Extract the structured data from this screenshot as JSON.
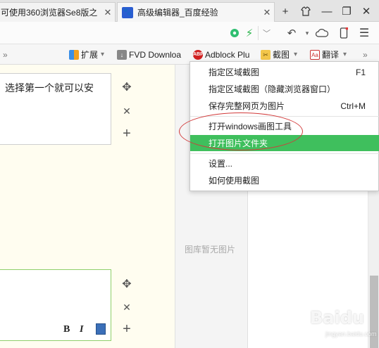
{
  "tabs": [
    {
      "title": "可使用360浏览器Se8版之",
      "close": "✕"
    },
    {
      "title": "高级编辑器_百度经验",
      "close": "✕",
      "favicon": "paw-icon"
    }
  ],
  "window_controls": {
    "new_tab": "+",
    "skin": "⌂",
    "minimize": "—",
    "restore": "❐",
    "close": "✕"
  },
  "toolbar": {
    "icons": [
      "color-wheel-icon",
      "lightning-icon",
      "chevron-down-icon",
      "undo-icon",
      "cloud-icon",
      "phone-icon",
      "menu-icon"
    ]
  },
  "extensions": {
    "overflow_left": "»",
    "items": [
      {
        "label": "扩展",
        "icon": "grid-icon"
      },
      {
        "label": "FVD Downloa",
        "icon": "download-icon"
      },
      {
        "label": "Adblock Plu",
        "icon": "abp-icon"
      },
      {
        "label": "截图",
        "icon": "scissors-icon"
      },
      {
        "label": "翻译",
        "icon": "translate-icon"
      }
    ],
    "overflow_right": "»"
  },
  "editor": {
    "block1_text": "选择第一个就可以安",
    "format_bold": "B",
    "format_italic": "I"
  },
  "gallery": {
    "empty_text": "图库暂无图片"
  },
  "menu": {
    "items": [
      {
        "label": "指定区域截图",
        "shortcut": "F1"
      },
      {
        "label": "指定区域截图（隐藏浏览器窗口）",
        "shortcut": ""
      },
      {
        "label": "保存完整网页为图片",
        "shortcut": "Ctrl+M"
      },
      {
        "label": "打开windows画图工具",
        "shortcut": ""
      },
      {
        "label": "打开图片文件夹",
        "shortcut": "",
        "highlighted": true
      },
      {
        "label": "设置...",
        "shortcut": ""
      },
      {
        "label": "如何使用截图",
        "shortcut": ""
      }
    ]
  },
  "watermark": {
    "brand": "Baidu",
    "sub": "jingyan.baidu.com"
  },
  "colors": {
    "highlight": "#3fbf5d",
    "annotation": "#d23a3a",
    "active_border": "#8fcf6a"
  }
}
